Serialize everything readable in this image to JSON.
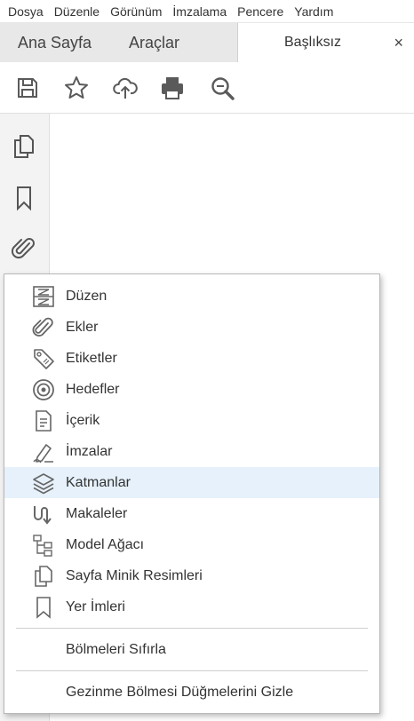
{
  "menubar": {
    "items": [
      "Dosya",
      "Düzenle",
      "Görünüm",
      "İmzalama",
      "Pencere",
      "Yardım"
    ]
  },
  "tabs": {
    "home_label": "Ana Sayfa",
    "tools_label": "Araçlar",
    "document_label": "Başlıksız",
    "close_glyph": "×"
  },
  "toolbar": {
    "buttons": [
      "save-icon",
      "star-icon",
      "cloud-upload-icon",
      "print-icon",
      "zoom-icon"
    ]
  },
  "leftnav": {
    "buttons": [
      "pages-icon",
      "bookmark-icon",
      "attachment-icon"
    ]
  },
  "context_menu": {
    "items": [
      {
        "label": "Düzen",
        "icon": "layout-icon"
      },
      {
        "label": "Ekler",
        "icon": "paperclip-icon"
      },
      {
        "label": "Etiketler",
        "icon": "tag-icon"
      },
      {
        "label": "Hedefler",
        "icon": "target-icon"
      },
      {
        "label": "İçerik",
        "icon": "document-icon"
      },
      {
        "label": "İmzalar",
        "icon": "pen-icon"
      },
      {
        "label": "Katmanlar",
        "icon": "layers-icon",
        "highlighted": true
      },
      {
        "label": "Makaleler",
        "icon": "article-icon"
      },
      {
        "label": "Model Ağacı",
        "icon": "tree-icon"
      },
      {
        "label": "Sayfa Minik Resimleri",
        "icon": "pages-icon"
      },
      {
        "label": "Yer İmleri",
        "icon": "bookmark-icon"
      }
    ],
    "reset_label": "Bölmeleri Sıfırla",
    "hide_label": "Gezinme Bölmesi Düğmelerini Gizle"
  },
  "colors": {
    "highlight": "#e6f1fb",
    "icon": "#555555",
    "toolbar_icon": "#5a5a5a"
  }
}
